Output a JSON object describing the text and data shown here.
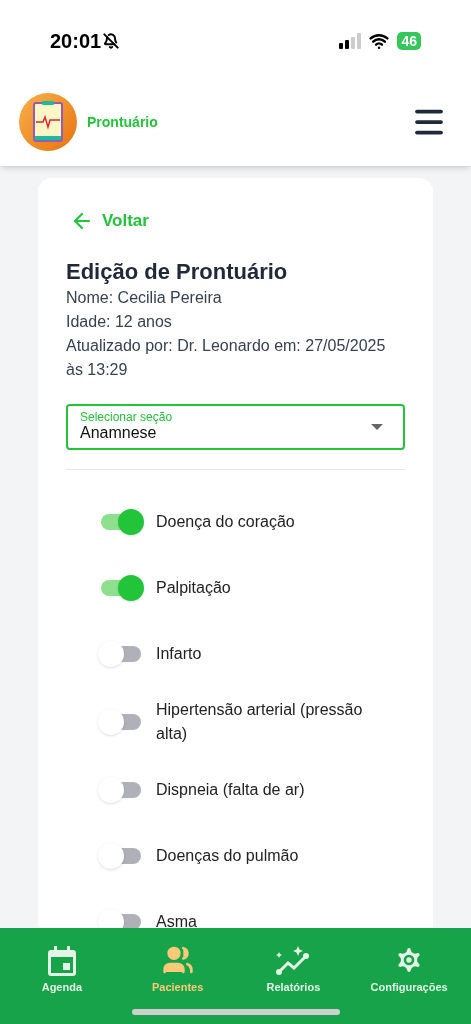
{
  "status_bar": {
    "time": "20:01",
    "battery": "46"
  },
  "header": {
    "title": "Prontuário"
  },
  "card": {
    "back": "Voltar",
    "title": "Edição de Prontuário",
    "lines": [
      "Nome: Cecilia Pereira",
      "Idade: 12 anos",
      "Atualizado por: Dr. Leonardo em: 27/05/2025 às 13:29"
    ],
    "select": {
      "label": "Selecionar seção",
      "value": "Anamnese"
    },
    "toggles": [
      {
        "label": "Doença do coração",
        "on": true
      },
      {
        "label": "Palpitação",
        "on": true
      },
      {
        "label": "Infarto",
        "on": false
      },
      {
        "label": "Hipertensão arterial (pressão alta)",
        "on": false
      },
      {
        "label": "Dispneia (falta de ar)",
        "on": false
      },
      {
        "label": "Doenças do pulmão",
        "on": false
      },
      {
        "label": "Asma",
        "on": false
      }
    ]
  },
  "nav": [
    {
      "label": "Agenda",
      "selected": false,
      "kind": "calendar"
    },
    {
      "label": "Pacientes",
      "selected": true,
      "kind": "people"
    },
    {
      "label": "Relatórios",
      "selected": false,
      "kind": "chart"
    },
    {
      "label": "Configurações",
      "selected": false,
      "kind": "gear"
    }
  ]
}
